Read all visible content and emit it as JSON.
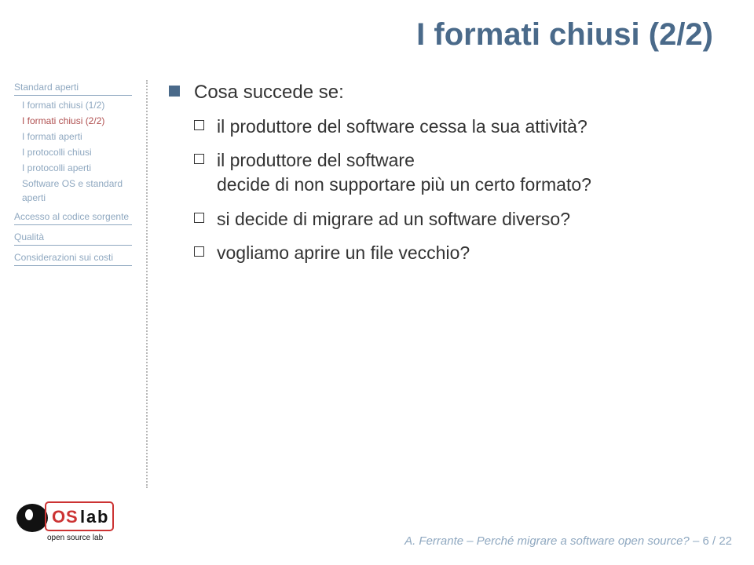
{
  "title": "I formati chiusi (2/2)",
  "sidebar": {
    "sections": [
      {
        "head": "Standard aperti",
        "items": [
          {
            "label": "I formati chiusi (1/2)",
            "active": false
          },
          {
            "label": "I formati chiusi (2/2)",
            "active": true
          },
          {
            "label": "I formati aperti",
            "active": false
          },
          {
            "label": "I protocolli chiusi",
            "active": false
          },
          {
            "label": "I protocolli aperti",
            "active": false
          },
          {
            "label": "Software OS e standard aperti",
            "active": false
          }
        ]
      },
      {
        "head": "Accesso al codice sorgente",
        "items": []
      },
      {
        "head": "Qualità",
        "items": []
      },
      {
        "head": "Considerazioni sui costi",
        "items": []
      }
    ]
  },
  "content": {
    "lead": "Cosa succede se:",
    "subs": [
      "il produttore del software cessa la sua attività?",
      "il produttore del software\ndecide di non supportare più un certo formato?",
      "si decide di migrare ad un software diverso?",
      "vogliamo aprire un file vecchio?"
    ]
  },
  "logo": {
    "tag": "open source lab",
    "letters": [
      "O",
      "S",
      "l",
      "a",
      "b"
    ]
  },
  "footer": {
    "author": "A. Ferrante",
    "sep": " – ",
    "talk": "Perché migrare a software open source?",
    "page_sep": " – ",
    "page": "6 / 22"
  }
}
